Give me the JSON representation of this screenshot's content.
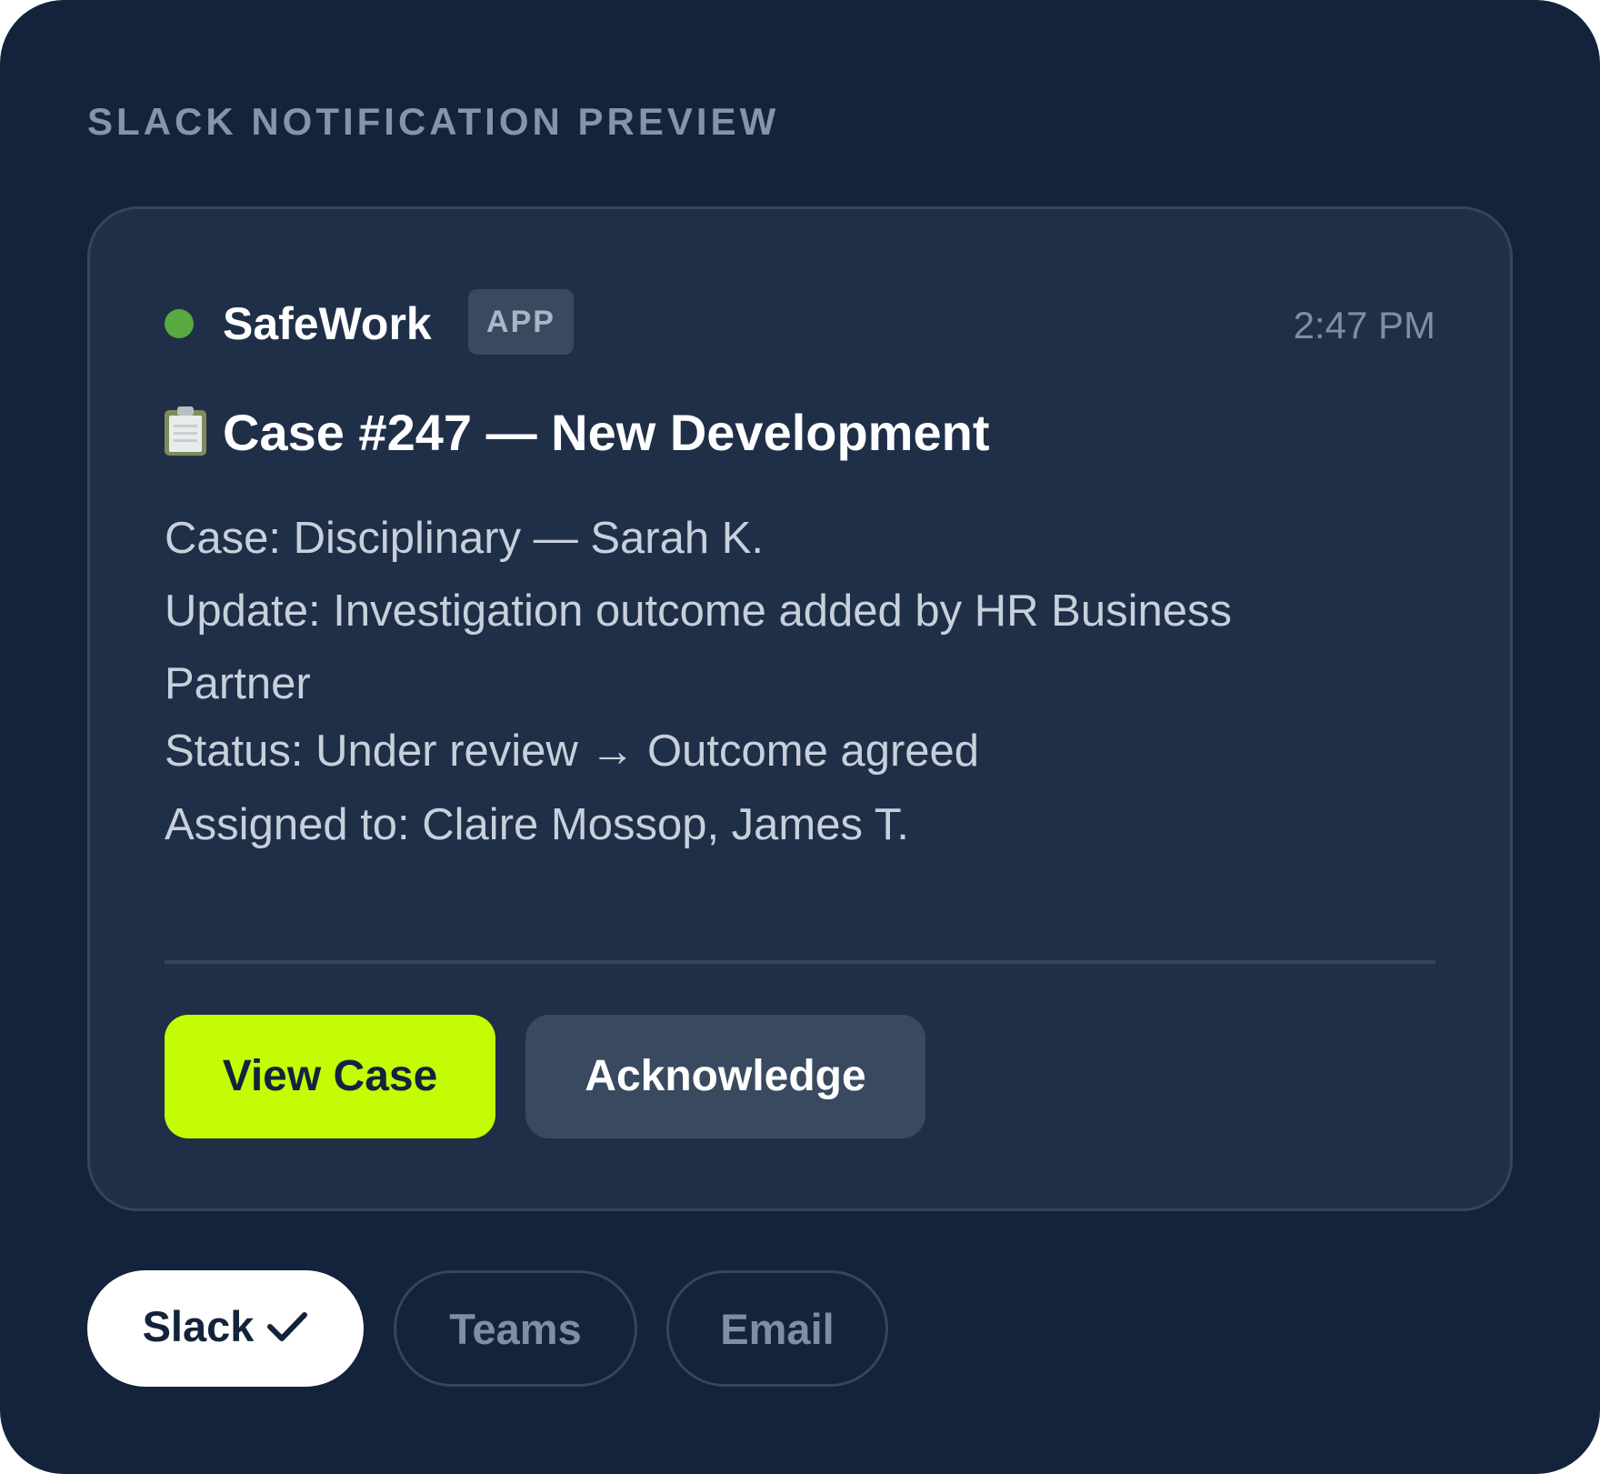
{
  "preview": {
    "label": "SLACK NOTIFICATION PREVIEW"
  },
  "message": {
    "app_name": "SafeWork",
    "badge": "APP",
    "time": "2:47 PM",
    "title": "Case #247 — New Development",
    "title_icon": "clipboard-icon",
    "status_dot_color": "#58a93f",
    "details": {
      "case": "Case: Disciplinary — Sarah K.",
      "update": "Update: Investigation outcome added by HR Business Partner",
      "status": "Status: Under review → Outcome agreed",
      "assigned": "Assigned to: Claire Mossop, James T."
    },
    "actions": {
      "view_case": "View Case",
      "acknowledge": "Acknowledge"
    }
  },
  "channels": {
    "selected": "Slack",
    "items": [
      {
        "label": "Slack",
        "icon": "check-icon"
      },
      {
        "label": "Teams"
      },
      {
        "label": "Email"
      }
    ]
  },
  "colors": {
    "background": "#13233c",
    "card": "#1f2f48",
    "accent": "#c4fc06",
    "secondary_button": "#394960"
  }
}
